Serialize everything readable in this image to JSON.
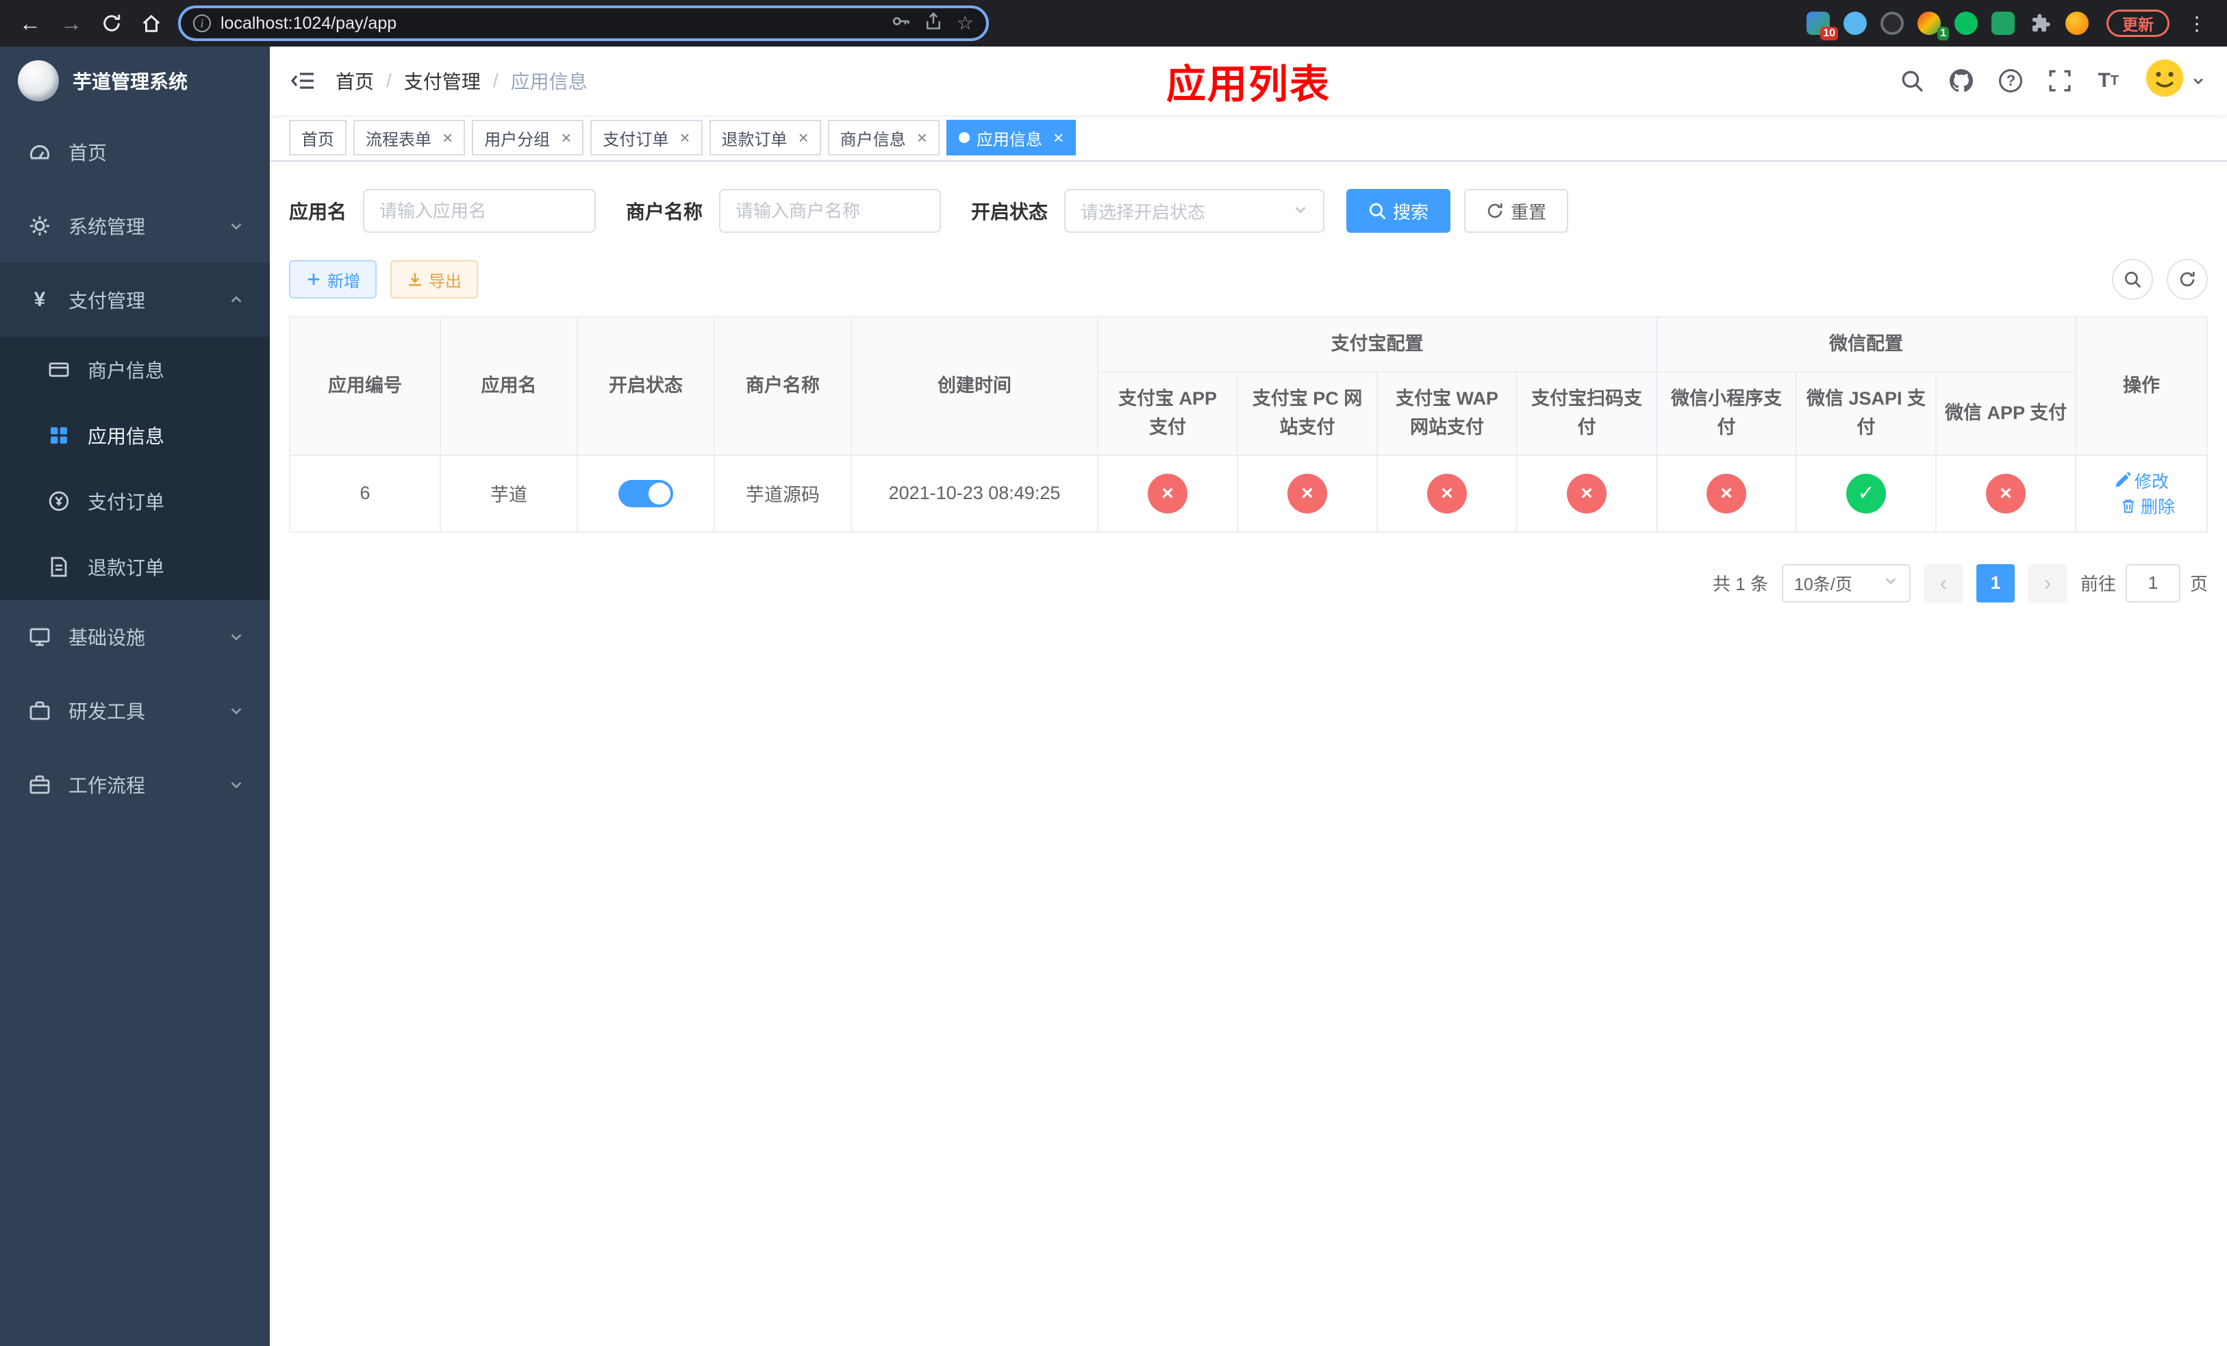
{
  "theme": {
    "accent": "#409eff",
    "danger": "#f56c6c",
    "success": "#13ce66",
    "sidebar_bg": "#304156",
    "sidebar_sub_bg": "#1f2d3d",
    "title_red": "#fe0000",
    "warning": "#e6a23c"
  },
  "icons": {
    "yes": "✓",
    "no": "×"
  },
  "browser": {
    "url": "localhost:1024/pay/app",
    "update_label": "更新",
    "ext_badge_a": "10",
    "ext_badge_b": "1"
  },
  "sidebar": {
    "title": "芋道管理系统",
    "menu": {
      "home": "首页",
      "system": "系统管理",
      "payment": "支付管理",
      "merchant_info": "商户信息",
      "app_info": "应用信息",
      "pay_order": "支付订单",
      "refund_order": "退款订单",
      "infra": "基础设施",
      "dev_tools": "研发工具",
      "workflow": "工作流程"
    }
  },
  "header": {
    "breadcrumb": [
      "首页",
      "支付管理",
      "应用信息"
    ],
    "title": "应用列表"
  },
  "tabs": [
    "首页",
    "流程表单",
    "用户分组",
    "支付订单",
    "退款订单",
    "商户信息",
    "应用信息"
  ],
  "filters": {
    "app_name_label": "应用名",
    "app_name_placeholder": "请输入应用名",
    "merchant_label": "商户名称",
    "merchant_placeholder": "请输入商户名称",
    "status_label": "开启状态",
    "status_placeholder": "请选择开启状态",
    "search": "搜索",
    "reset": "重置"
  },
  "toolbar": {
    "add": "新增",
    "export": "导出"
  },
  "table": {
    "columns": {
      "app_id": "应用编号",
      "app_name": "应用名",
      "status": "开启状态",
      "merchant": "商户名称",
      "created": "创建时间",
      "actions": "操作"
    },
    "groups": {
      "alipay": "支付宝配置",
      "wechat": "微信配置"
    },
    "alipay_columns": [
      "支付宝 APP 支付",
      "支付宝 PC 网站支付",
      "支付宝 WAP 网站支付",
      "支付宝扫码支付"
    ],
    "wechat_columns": [
      "微信小程序支付",
      "微信 JSAPI 支付",
      "微信 APP 支付"
    ],
    "rows": [
      {
        "app_id": "6",
        "app_name": "芋道",
        "enabled": true,
        "merchant": "芋道源码",
        "created": "2021-10-23 08:49:25",
        "statuses": {
          "alipay_app": false,
          "alipay_pc": false,
          "alipay_wap": false,
          "alipay_qr": false,
          "wechat_mini": false,
          "wechat_jsapi": true,
          "wechat_app": false
        },
        "edit": "修改",
        "delete": "删除"
      }
    ]
  },
  "pagination": {
    "total": "共 1 条",
    "page_size": "10条/页",
    "page": "1",
    "goto": "前往",
    "goto_value": "1",
    "unit": "页"
  }
}
